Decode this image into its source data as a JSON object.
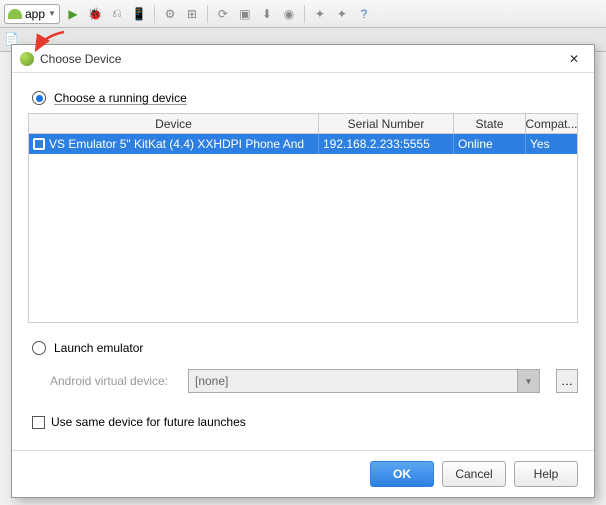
{
  "toolbar": {
    "config_label": "app"
  },
  "dialog": {
    "title": "Choose Device",
    "choose_running_label": "Choose a running device",
    "table": {
      "headers": {
        "device": "Device",
        "serial": "Serial Number",
        "state": "State",
        "compat": "Compat..."
      },
      "rows": [
        {
          "device": "VS Emulator 5\" KitKat (4.4) XXHDPI Phone And",
          "serial": "192.168.2.233:5555",
          "state": "Online",
          "compat": "Yes"
        }
      ]
    },
    "launch_emulator_label": "Launch emulator",
    "avd_label": "Android virtual device:",
    "avd_selected": "[none]",
    "use_same_label": "Use same device for future launches",
    "buttons": {
      "ok": "OK",
      "cancel": "Cancel",
      "help": "Help"
    }
  }
}
